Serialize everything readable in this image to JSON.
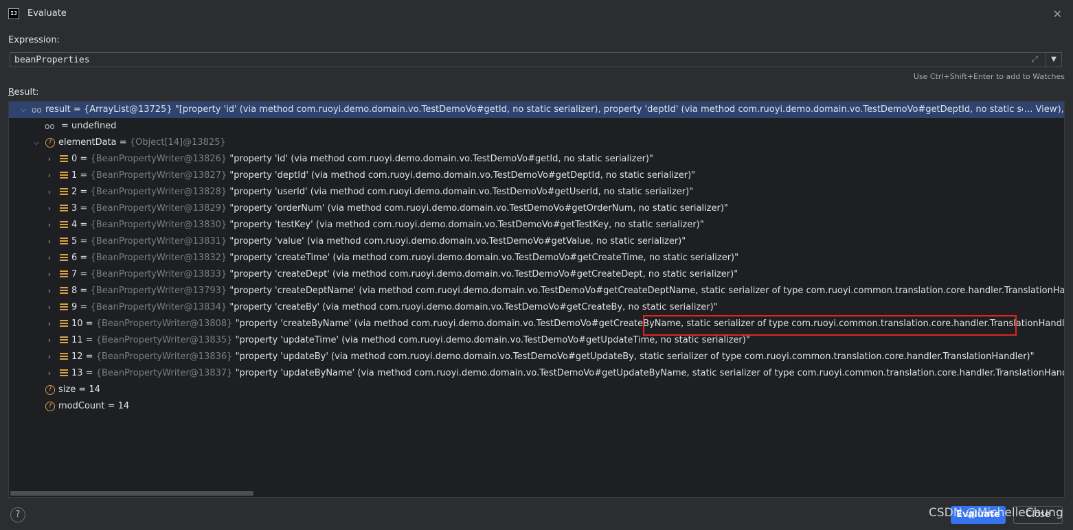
{
  "window": {
    "title": "Evaluate",
    "icon_text": "IJ",
    "close_icon": "close-icon"
  },
  "expression": {
    "label": "Expression:",
    "value": "beanProperties",
    "hint": "Use Ctrl+Shift+Enter to add to Watches"
  },
  "result": {
    "label_underline": "R",
    "label_rest": "esult:",
    "root": {
      "name": "result",
      "ref": "{ArrayList@13725}",
      "value": "\"[property 'id' (via method com.ruoyi.demo.domain.vo.TestDemoVo#getId, no static serializer), property 'deptId' (via method com.ruoyi.demo.domain.vo.TestDemoVo#getDeptId, no static serializer), property",
      "view_link": "... View"
    },
    "undefined_row": {
      "name": "= undefined"
    },
    "element_data": {
      "name": "elementData",
      "ref": "{Object[14]@13825}"
    },
    "items": [
      {
        "index": "0",
        "ref": "{BeanPropertyWriter@13826}",
        "value": "\"property 'id' (via method com.ruoyi.demo.domain.vo.TestDemoVo#getId, no static serializer)\""
      },
      {
        "index": "1",
        "ref": "{BeanPropertyWriter@13827}",
        "value": "\"property 'deptId' (via method com.ruoyi.demo.domain.vo.TestDemoVo#getDeptId, no static serializer)\""
      },
      {
        "index": "2",
        "ref": "{BeanPropertyWriter@13828}",
        "value": "\"property 'userId' (via method com.ruoyi.demo.domain.vo.TestDemoVo#getUserId, no static serializer)\""
      },
      {
        "index": "3",
        "ref": "{BeanPropertyWriter@13829}",
        "value": "\"property 'orderNum' (via method com.ruoyi.demo.domain.vo.TestDemoVo#getOrderNum, no static serializer)\""
      },
      {
        "index": "4",
        "ref": "{BeanPropertyWriter@13830}",
        "value": "\"property 'testKey' (via method com.ruoyi.demo.domain.vo.TestDemoVo#getTestKey, no static serializer)\""
      },
      {
        "index": "5",
        "ref": "{BeanPropertyWriter@13831}",
        "value": "\"property 'value' (via method com.ruoyi.demo.domain.vo.TestDemoVo#getValue, no static serializer)\""
      },
      {
        "index": "6",
        "ref": "{BeanPropertyWriter@13832}",
        "value": "\"property 'createTime' (via method com.ruoyi.demo.domain.vo.TestDemoVo#getCreateTime, no static serializer)\""
      },
      {
        "index": "7",
        "ref": "{BeanPropertyWriter@13833}",
        "value": "\"property 'createDept' (via method com.ruoyi.demo.domain.vo.TestDemoVo#getCreateDept, no static serializer)\""
      },
      {
        "index": "8",
        "ref": "{BeanPropertyWriter@13793}",
        "value": "\"property 'createDeptName' (via method com.ruoyi.demo.domain.vo.TestDemoVo#getCreateDeptName, static serializer of type com.ruoyi.common.translation.core.handler.TranslationHandler)\""
      },
      {
        "index": "9",
        "ref": "{BeanPropertyWriter@13834}",
        "value": "\"property 'createBy' (via method com.ruoyi.demo.domain.vo.TestDemoVo#getCreateBy, no static serializer)\""
      },
      {
        "index": "10",
        "ref": "{BeanPropertyWriter@13808}",
        "value": "\"property 'createByName' (via method com.ruoyi.demo.domain.vo.TestDemoVo#getCreateByName, static serializer of type com.ruoyi.common.translation.core.handler.TranslationHandler)\""
      },
      {
        "index": "11",
        "ref": "{BeanPropertyWriter@13835}",
        "value": "\"property 'updateTime' (via method com.ruoyi.demo.domain.vo.TestDemoVo#getUpdateTime, no static serializer)\""
      },
      {
        "index": "12",
        "ref": "{BeanPropertyWriter@13836}",
        "value": "\"property 'updateBy' (via method com.ruoyi.demo.domain.vo.TestDemoVo#getUpdateBy, static serializer of type com.ruoyi.common.translation.core.handler.TranslationHandler)\""
      },
      {
        "index": "13",
        "ref": "{BeanPropertyWriter@13837}",
        "value": "\"property 'updateByName' (via method com.ruoyi.demo.domain.vo.TestDemoVo#getUpdateByName, static serializer of type com.ruoyi.common.translation.core.handler.TranslationHandler)\""
      }
    ],
    "size_row": "size = 14",
    "modcount_row": "modCount = 14"
  },
  "footer": {
    "help": "?",
    "evaluate": "Evaluate",
    "close": "Close",
    "watermark": "CSDN @MichelleChung"
  },
  "colors": {
    "background": "#2b2d30",
    "tree_background": "#1e1f22",
    "selected_row": "#2e436e",
    "accent": "#3574f0",
    "highlight_box": "#e02424"
  }
}
